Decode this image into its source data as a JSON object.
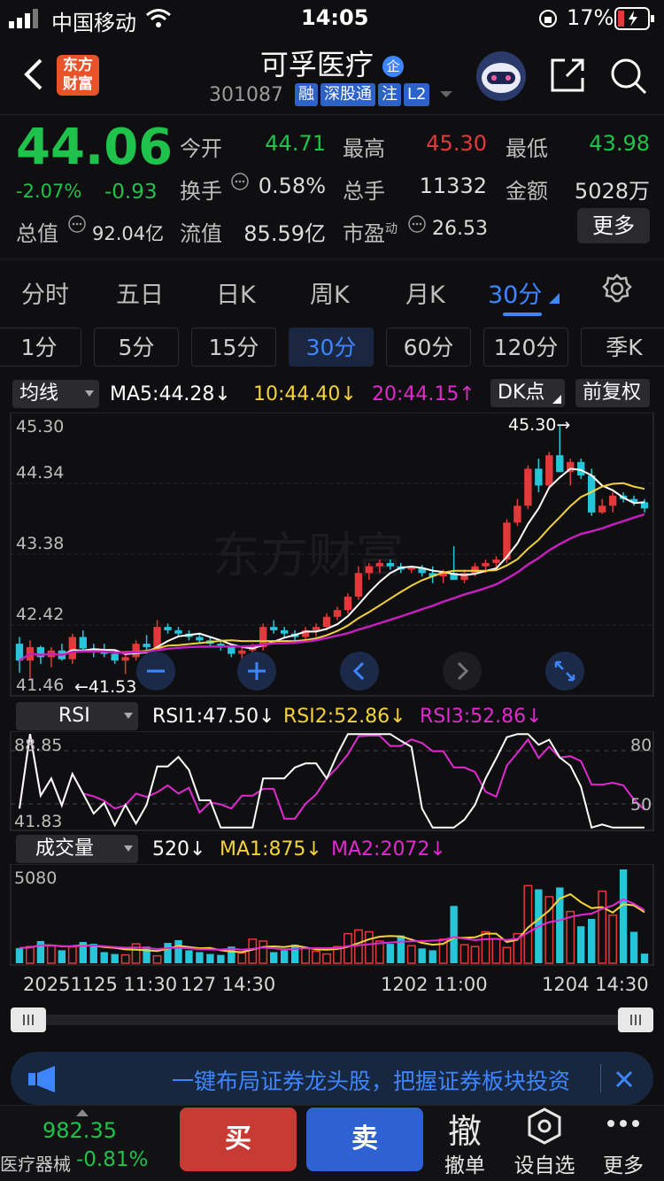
{
  "status": {
    "carrier": "中国移动",
    "time": "14:05",
    "battery": "17%"
  },
  "header": {
    "logo_text": "东方财富",
    "stock_name": "可孚医疗",
    "stock_code": "301087",
    "tags": [
      "融",
      "深股通",
      "注",
      "L2"
    ],
    "corp_badge": "企"
  },
  "quote": {
    "price": "44.06",
    "change_pct": "-2.07%",
    "change": "-0.93",
    "open_label": "今开",
    "open": "44.71",
    "high_label": "最高",
    "high": "45.30",
    "low_label": "最低",
    "low": "43.98",
    "turnover_label": "换手",
    "turnover": "0.58%",
    "volume_label": "总手",
    "volume": "11332",
    "amount_label": "金额",
    "amount": "5028万",
    "mktcap_label": "总值",
    "mktcap": "92.04亿",
    "float_label": "流值",
    "float": "85.59亿",
    "pe_label": "市盈",
    "pe_sup": "动",
    "pe": "26.53",
    "more": "更多"
  },
  "period_tabs": [
    "分时",
    "五日",
    "日K",
    "周K",
    "月K",
    "30分"
  ],
  "minute_tabs": [
    "1分",
    "5分",
    "15分",
    "30分",
    "60分",
    "120分",
    "季K"
  ],
  "main_pane": {
    "indicator": "均线",
    "ma5": "MA5:44.28↓",
    "ma10": "10:44.40↓",
    "ma20": "20:44.15↑",
    "dk": "DK点",
    "adjust": "前复权",
    "y_labels": [
      "45.30",
      "44.34",
      "43.38",
      "42.42",
      "41.46"
    ],
    "high_marker": "45.30→",
    "low_marker": "←41.53",
    "watermark": "东方财富"
  },
  "rsi_pane": {
    "indicator": "RSI",
    "rsi1": "RSI1:47.50↓",
    "rsi2": "RSI2:52.86↓",
    "rsi3": "RSI3:52.86↓",
    "y_top": "88.85",
    "y_bottom": "41.83",
    "lvl80": "80",
    "lvl50": "50"
  },
  "vol_pane": {
    "indicator": "成交量",
    "vol": "520↓",
    "ma1": "MA1:875↓",
    "ma2": "MA2:2072↓",
    "y_top": "5080"
  },
  "time_axis": [
    "20251125 11:30",
    "127 14:30",
    "1202 11:00",
    "1204 14:30"
  ],
  "banner": {
    "text": "一键布局证券龙头股，把握证券板块投资"
  },
  "bottom": {
    "index_value": "982.35",
    "index_name": "医疗器械",
    "index_change": "-0.81%",
    "buy": "买",
    "sell": "卖",
    "cancel_icon": "撤",
    "cancel": "撤单",
    "watch": "设自选",
    "more": "更多"
  },
  "chart_data": {
    "type": "candlestick",
    "ylim": [
      41.46,
      45.3
    ],
    "candles": [
      [
        42.05,
        42.15,
        41.62,
        41.8
      ],
      [
        41.8,
        42.1,
        41.53,
        42.0
      ],
      [
        42.0,
        42.02,
        41.75,
        41.85
      ],
      [
        41.85,
        42.0,
        41.7,
        41.95
      ],
      [
        41.95,
        42.05,
        41.8,
        41.82
      ],
      [
        41.82,
        42.2,
        41.75,
        42.15
      ],
      [
        42.15,
        42.25,
        41.95,
        41.98
      ],
      [
        41.98,
        42.05,
        41.85,
        41.95
      ],
      [
        41.95,
        42.05,
        41.85,
        41.9
      ],
      [
        41.9,
        41.95,
        41.75,
        41.8
      ],
      [
        41.8,
        41.9,
        41.6,
        41.85
      ],
      [
        41.85,
        42.1,
        41.8,
        42.05
      ],
      [
        42.05,
        42.18,
        41.95,
        42.0
      ],
      [
        42.0,
        42.4,
        41.95,
        42.3
      ],
      [
        42.3,
        42.35,
        42.2,
        42.25
      ],
      [
        42.25,
        42.3,
        42.15,
        42.2
      ],
      [
        42.2,
        42.25,
        42.1,
        42.15
      ],
      [
        42.15,
        42.2,
        42.05,
        42.1
      ],
      [
        42.1,
        42.15,
        42.0,
        42.05
      ],
      [
        42.05,
        42.1,
        41.95,
        42.0
      ],
      [
        42.0,
        42.05,
        41.85,
        41.9
      ],
      [
        41.9,
        42.0,
        41.75,
        41.95
      ],
      [
        41.95,
        42.05,
        41.85,
        42.0
      ],
      [
        42.0,
        42.35,
        41.95,
        42.3
      ],
      [
        42.3,
        42.4,
        42.2,
        42.25
      ],
      [
        42.25,
        42.3,
        42.15,
        42.2
      ],
      [
        42.2,
        42.25,
        42.1,
        42.15
      ],
      [
        42.15,
        42.3,
        42.1,
        42.25
      ],
      [
        42.25,
        42.35,
        42.15,
        42.3
      ],
      [
        42.3,
        42.5,
        42.25,
        42.45
      ],
      [
        42.45,
        42.6,
        42.4,
        42.55
      ],
      [
        42.55,
        42.8,
        42.5,
        42.75
      ],
      [
        42.75,
        43.2,
        42.7,
        43.1
      ],
      [
        43.1,
        43.25,
        43.0,
        43.2
      ],
      [
        43.2,
        43.3,
        43.1,
        43.25
      ],
      [
        43.25,
        43.3,
        43.15,
        43.2
      ],
      [
        43.2,
        43.25,
        43.1,
        43.15
      ],
      [
        43.15,
        43.2,
        43.1,
        43.18
      ],
      [
        43.18,
        43.22,
        43.05,
        43.1
      ],
      [
        43.1,
        43.2,
        42.95,
        43.05
      ],
      [
        43.05,
        43.15,
        42.95,
        43.1
      ],
      [
        43.1,
        43.5,
        43.0,
        43.0
      ],
      [
        43.0,
        43.15,
        42.95,
        43.1
      ],
      [
        43.1,
        43.25,
        43.05,
        43.2
      ],
      [
        43.2,
        43.3,
        43.1,
        43.25
      ],
      [
        43.25,
        43.35,
        43.15,
        43.3
      ],
      [
        43.3,
        43.9,
        43.25,
        43.85
      ],
      [
        43.85,
        44.2,
        43.8,
        44.1
      ],
      [
        44.1,
        44.7,
        44.05,
        44.65
      ],
      [
        44.65,
        44.8,
        44.3,
        44.4
      ],
      [
        44.4,
        44.9,
        44.35,
        44.85
      ],
      [
        44.85,
        45.3,
        44.6,
        44.6
      ],
      [
        44.6,
        44.8,
        44.4,
        44.75
      ],
      [
        44.75,
        44.8,
        44.5,
        44.55
      ],
      [
        44.55,
        44.65,
        43.95,
        44.0
      ],
      [
        44.0,
        44.2,
        43.98,
        44.1
      ],
      [
        44.1,
        44.3,
        44.0,
        44.25
      ],
      [
        44.25,
        44.3,
        44.15,
        44.2
      ],
      [
        44.2,
        44.25,
        44.1,
        44.15
      ],
      [
        44.15,
        44.2,
        44.0,
        44.06
      ]
    ],
    "volumes": [
      820,
      900,
      1200,
      950,
      700,
      880,
      1150,
      1050,
      600,
      500,
      450,
      1050,
      900,
      400,
      1100,
      1250,
      700,
      600,
      500,
      450,
      900,
      550,
      1300,
      1200,
      600,
      700,
      1000,
      800,
      650,
      500,
      900,
      1600,
      1800,
      1700,
      1200,
      1050,
      1500,
      950,
      800,
      700,
      1300,
      3100,
      1000,
      900,
      1700,
      1300,
      850,
      1600,
      4200,
      4000,
      3600,
      4100,
      2800,
      2000,
      2400,
      3900,
      2600,
      5080,
      1700,
      520
    ]
  }
}
